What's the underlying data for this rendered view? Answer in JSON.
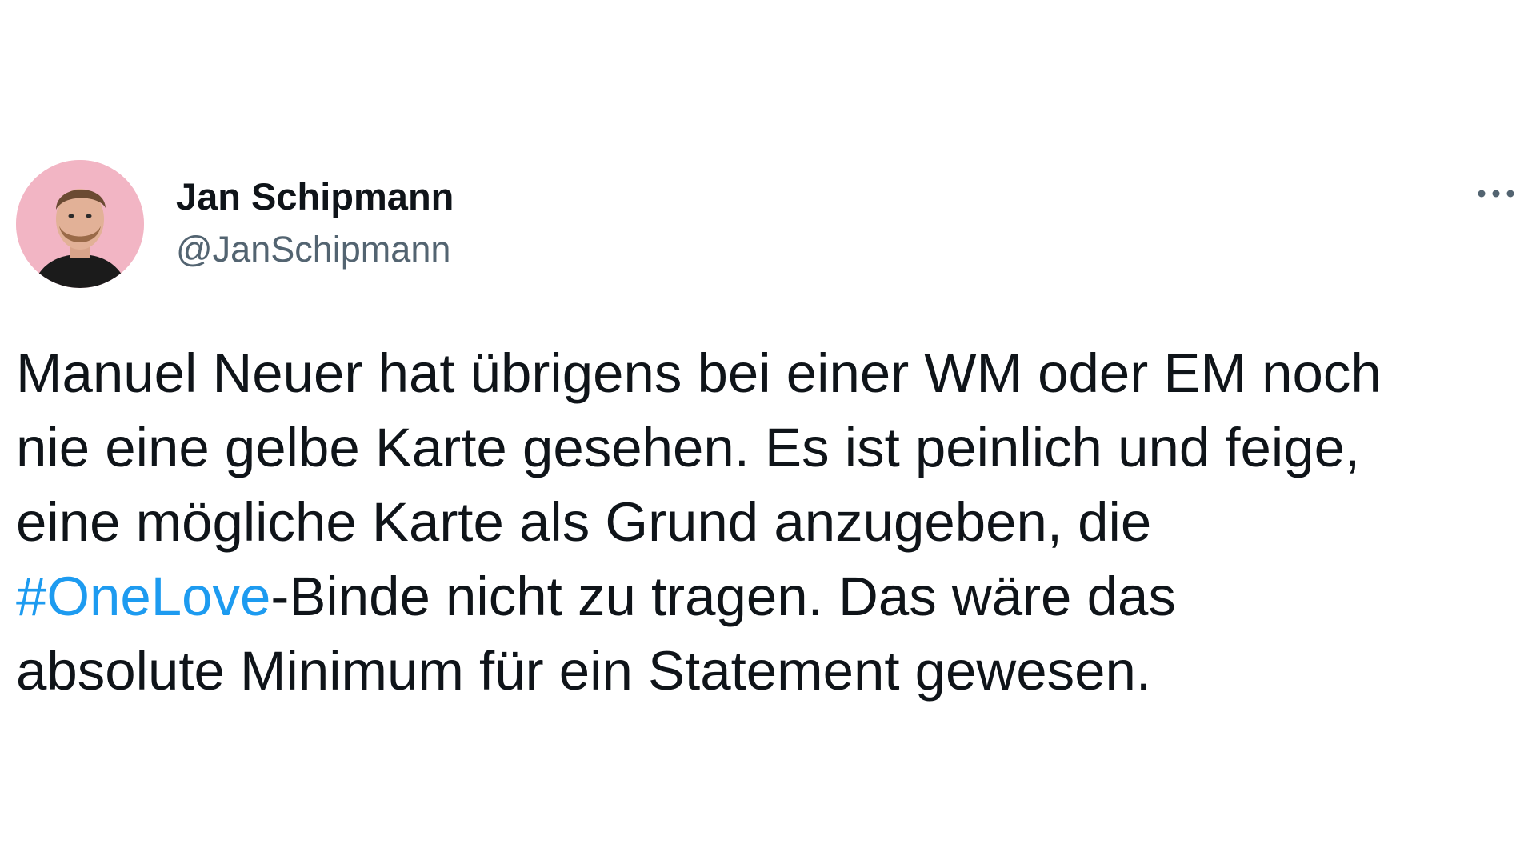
{
  "author": {
    "display_name": "Jan Schipmann",
    "handle": "@JanSchipmann"
  },
  "menu": {
    "icon": "more-horizontal-icon"
  },
  "tweet": {
    "line1": "Manuel Neuer hat übrigens bei einer WM oder EM noch",
    "line2": "nie eine gelbe Karte gesehen. Es ist peinlich und feige,",
    "line3": "eine mögliche Karte als Grund anzugeben, die",
    "line4_hashtag": "#OneLove",
    "line4_rest": "-Binde nicht zu tragen. Das wäre das",
    "line5": "absolute Minimum für ein Statement gewesen."
  },
  "colors": {
    "text": "#0f1419",
    "secondary": "#536471",
    "link": "#1d9bf0",
    "avatar_bg": "#f2b5c4"
  }
}
